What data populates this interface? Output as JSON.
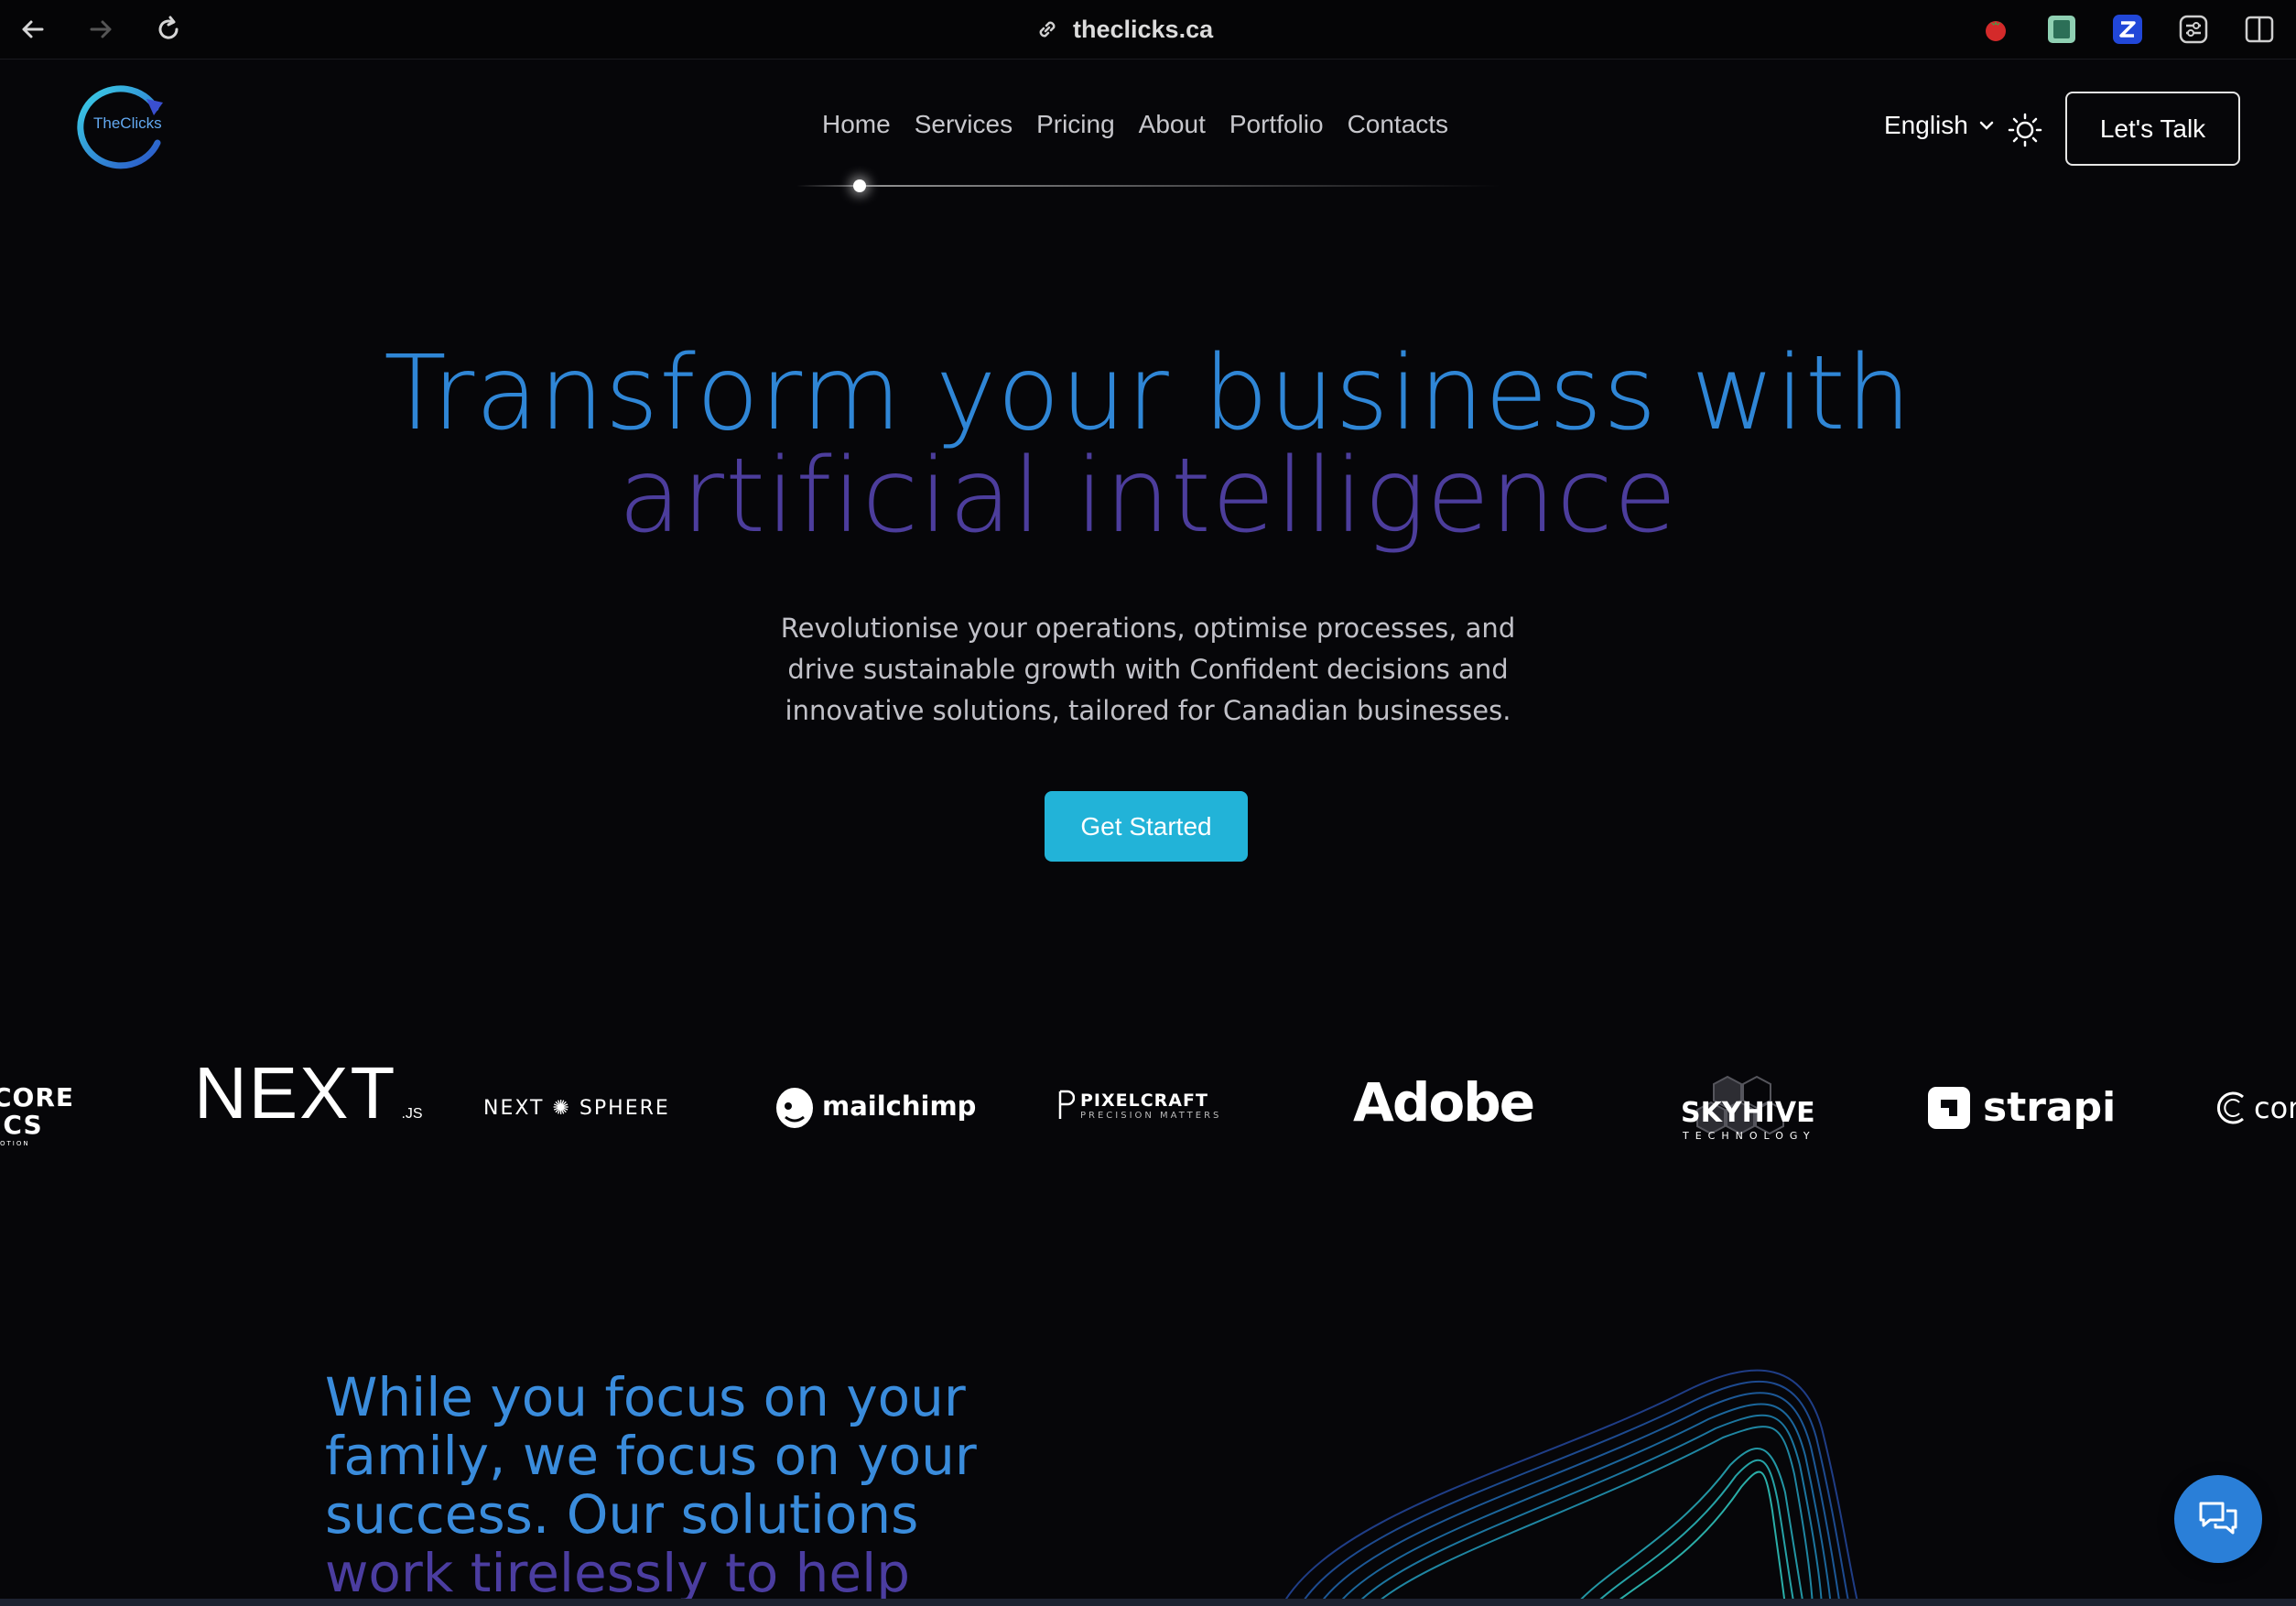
{
  "browser": {
    "url": "theclicks.ca"
  },
  "header": {
    "logo_text": "TheClicks",
    "nav": [
      "Home",
      "Services",
      "Pricing",
      "About",
      "Portfolio",
      "Contacts"
    ],
    "language": "English",
    "cta_label": "Let's Talk"
  },
  "hero": {
    "title_line1": "Transform your business with",
    "title_line2": "artificial intelligence",
    "subtitle": "Revolutionise your operations, optimise processes, and drive sustainable growth with Confident decisions and innovative solutions, tailored for Canadian businesses.",
    "cta_label": "Get Started"
  },
  "logos": {
    "core_top": "CORE",
    "core_bottom": "ICS",
    "core_tiny": "OTION",
    "next_main": "NEXT",
    "next_suffix": ".JS",
    "nextsphere_left": "NEXT",
    "nextsphere_right": "SPHERE",
    "mailchimp": "mailchimp",
    "pixelcraft": "PIXELCRAFT",
    "pixelcraft_tag": "PRECISION MATTERS",
    "adobe": "Adobe",
    "skyhive": "SKYHIVE",
    "skyhive_tag": "TECHNOLOGY",
    "strapi": "strapi",
    "partial": "con"
  },
  "section": {
    "line1": "While you focus on your",
    "line2": "family, we focus on your",
    "line3": "success. Our solutions",
    "line4": "work tirelessly to help"
  },
  "colors": {
    "background": "#060609",
    "accent_blue": "#2f86d6",
    "accent_purple": "#4c3d9c",
    "cta": "#22b3d8",
    "chat": "#2a7fd8"
  }
}
